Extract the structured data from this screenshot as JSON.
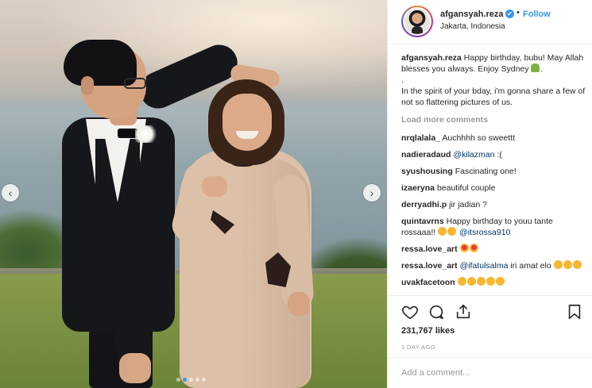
{
  "post": {
    "username": "afgansyah.reza",
    "verified_mark": "✔",
    "separator": "•",
    "follow_label": "Follow",
    "location": "Jakarta, Indonesia",
    "caption_line1": "Happy birthday, bubu! May Allah blesses you always. Enjoy Sydney",
    "caption_dot": ".",
    "caption_line2": "In the spirit of your bday, i'm gonna share a few of not so flattering pictures of us.",
    "load_more": "Load more comments",
    "likes": "231,767 likes",
    "time": "1 DAY AGO",
    "add_comment_placeholder": "Add a comment..."
  },
  "carousel": {
    "prev_glyph": "‹",
    "next_glyph": "›",
    "dot_count": 5,
    "active_dot": 1,
    "accent_color": "#3897f0"
  },
  "comments": [
    {
      "user": "nrqlalala_",
      "text": "Auchhhh so sweettt"
    },
    {
      "user": "nadieradaud",
      "mention": "@kilazman",
      "text": ":("
    },
    {
      "user": "syushousing",
      "text": "Fascinating one!"
    },
    {
      "user": "izaeryna",
      "text": "beautiful couple"
    },
    {
      "user": "derryadhi.p",
      "text": "jir jadian ?"
    },
    {
      "user": "quintavrns",
      "text": "Happy birthday to youu tante rossaaa!!",
      "mention": "@itsrossa910"
    },
    {
      "user": "ressa.love_art",
      "text": ""
    },
    {
      "user": "ressa.love_art",
      "mention": "@ifatulsalma",
      "text": "iri amat elo"
    },
    {
      "user": "uvakfacetoon",
      "text": ""
    }
  ],
  "icons": {
    "like": "heart-icon",
    "comment": "comment-icon",
    "share": "share-icon",
    "save": "bookmark-icon"
  },
  "colors": {
    "text": "#262626",
    "secondary": "#999999",
    "link": "#3897f0",
    "mention": "#003569",
    "divider": "#efefef"
  }
}
